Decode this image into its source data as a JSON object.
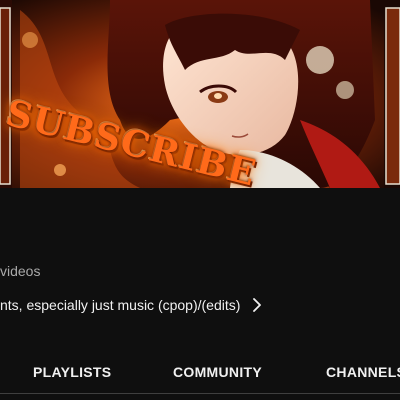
{
  "banner": {
    "overlay_text": "SUBSCRIBE"
  },
  "channel": {
    "videos_text": "videos",
    "description": "nts, especially just music (cpop)/(edits)"
  },
  "tabs": [
    {
      "label": "PLAYLISTS"
    },
    {
      "label": "COMMUNITY"
    },
    {
      "label": "CHANNELS"
    }
  ],
  "icons": {
    "description_more": "chevron-right-icon"
  },
  "colors": {
    "background": "#0f0f0f",
    "secondary_text": "#aaaaaa",
    "primary_text": "#f1f1f1",
    "banner_accent": "#ff6a1a"
  }
}
